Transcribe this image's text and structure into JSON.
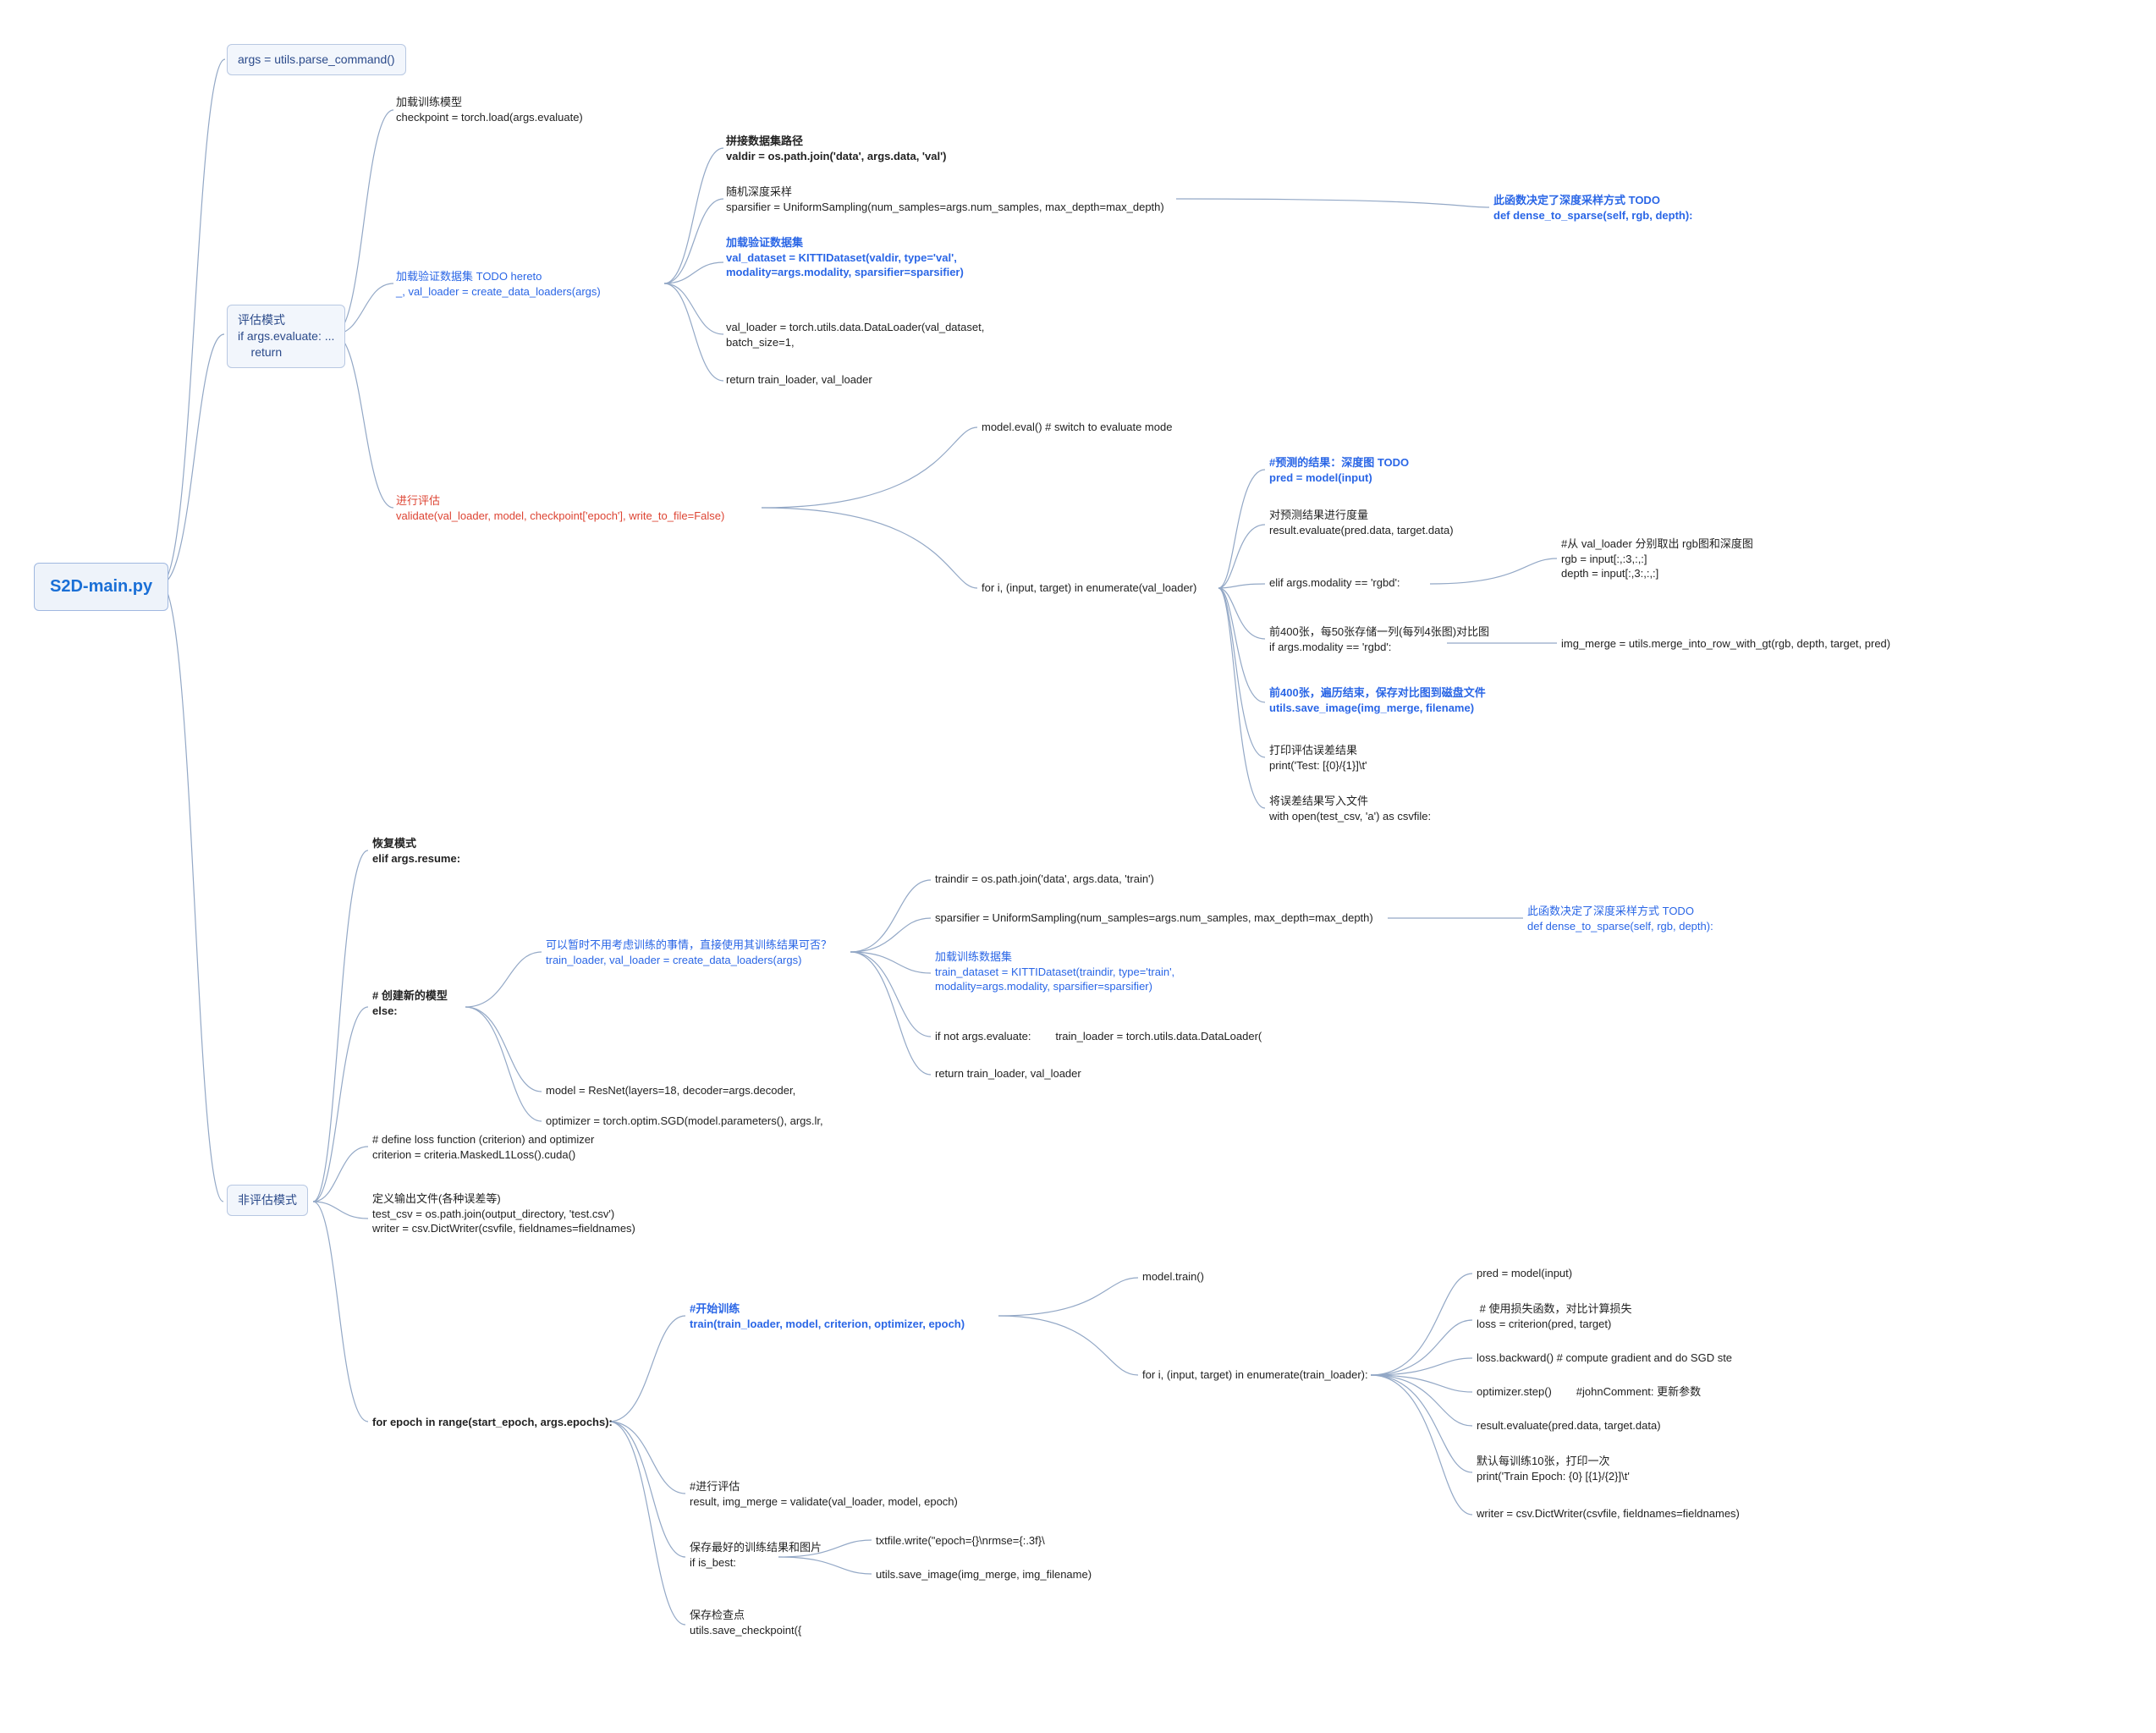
{
  "root": {
    "title": "S2D-main.py"
  },
  "top": {
    "args": "args = utils.parse_command()"
  },
  "eval_box": "评估模式\nif args.evaluate: ...\n    return",
  "eval": {
    "load_model": "加载训练模型\ncheckpoint = torch.load(args.evaluate)",
    "load_val_data": "加载验证数据集 TODO hereto\n_, val_loader = create_data_loaders(args)",
    "valdir": "拼接数据集路径\nvaldir = os.path.join('data', args.data, 'val')",
    "sparsifier": "随机深度采样\nsparsifier = UniformSampling(num_samples=args.num_samples, max_depth=max_depth)",
    "dense": "此函数决定了深度采样方式 TODO\ndef dense_to_sparse(self, rgb, depth):",
    "val_dataset": "加载验证数据集\nval_dataset = KITTIDataset(valdir, type='val',\nmodality=args.modality, sparsifier=sparsifier)",
    "val_loader": "val_loader = torch.utils.data.DataLoader(val_dataset,\nbatch_size=1,",
    "return": "return train_loader, val_loader",
    "validate": "进行评估\nvalidate(val_loader, model, checkpoint['epoch'], write_to_file=False)",
    "model_eval": "model.eval() # switch to evaluate mode",
    "for_loop": "for i, (input, target) in enumerate(val_loader)",
    "pred": "#预测的结果：深度图 TODO\npred = model(input)",
    "result_eval": "对预测结果进行度量\nresult.evaluate(pred.data, target.data)",
    "modality_rgbd": "elif args.modality == 'rgbd':",
    "rgb_depth": "#从 val_loader 分别取出 rgb图和深度图\nrgb = input[:,:3,:,:]\ndepth = input[:,3:,:,:]",
    "every50": "前400张，每50张存储一列(每列4张图)对比图\nif args.modality == 'rgbd':",
    "img_merge": "img_merge = utils.merge_into_row_with_gt(rgb, depth, target, pred)",
    "save_img": "前400张，遍历结束，保存对比图到磁盘文件\nutils.save_image(img_merge, filename)",
    "print_test": "打印评估误差结果\nprint('Test: [{0}/{1}]\\t'",
    "csv": "将误差结果写入文件\nwith open(test_csv, 'a') as csvfile:"
  },
  "noneval_label": "非评估模式",
  "resume": "恢复模式\nelif args.resume:",
  "else_block": "# 创建新的模型\nelse:",
  "else_sub": {
    "loaders": "可以暂时不用考虑训练的事情，直接使用其训练结果可否？\ntrain_loader, val_loader = create_data_loaders(args)",
    "traindir": "traindir = os.path.join('data', args.data, 'train')",
    "sparsifier2": "sparsifier = UniformSampling(num_samples=args.num_samples, max_depth=max_depth)",
    "dense2": "此函数决定了深度采样方式 TODO\ndef dense_to_sparse(self, rgb, depth):",
    "train_dataset": "加载训练数据集\ntrain_dataset = KITTIDataset(traindir, type='train',\nmodality=args.modality, sparsifier=sparsifier)",
    "if_not_eval": "if not args.evaluate:        train_loader = torch.utils.data.DataLoader(",
    "return2": "return train_loader, val_loader",
    "model": "model = ResNet(layers=18, decoder=args.decoder,",
    "optimizer": "optimizer = torch.optim.SGD(model.parameters(), args.lr,"
  },
  "criterion": "# define loss function (criterion) and optimizer\ncriterion = criteria.MaskedL1Loss().cuda()",
  "outputs": "定义输出文件(各种误差等)\ntest_csv = os.path.join(output_directory, 'test.csv')\nwriter = csv.DictWriter(csvfile, fieldnames=fieldnames)",
  "for_epoch": "for epoch in range(start_epoch, args.epochs):",
  "train_call": "#开始训练\ntrain(train_loader, model, criterion, optimizer, epoch)",
  "model_train": "model.train()",
  "for_train_loader": "for i, (input, target) in enumerate(train_loader):",
  "train_inner": {
    "pred": "pred = model(input)",
    "loss": " # 使用损失函数，对比计算损失\nloss = criterion(pred, target)",
    "backward": "loss.backward() # compute gradient and do SGD ste",
    "step": "optimizer.step()        #johnComment: 更新参数",
    "result": "result.evaluate(pred.data, target.data)",
    "print": "默认每训练10张，打印一次\nprint('Train Epoch: {0} [{1}/{2}]\\t'",
    "writer": "writer = csv.DictWriter(csvfile, fieldnames=fieldnames)"
  },
  "validate2": "#进行评估\nresult, img_merge = validate(val_loader, model, epoch)",
  "is_best": "保存最好的训练结果和图片\nif is_best:",
  "txtfile": "txtfile.write(\"epoch={}\\nrmse={:.3f}\\",
  "save_img2": "utils.save_image(img_merge, img_filename)",
  "checkpoint": "保存检查点\nutils.save_checkpoint({"
}
